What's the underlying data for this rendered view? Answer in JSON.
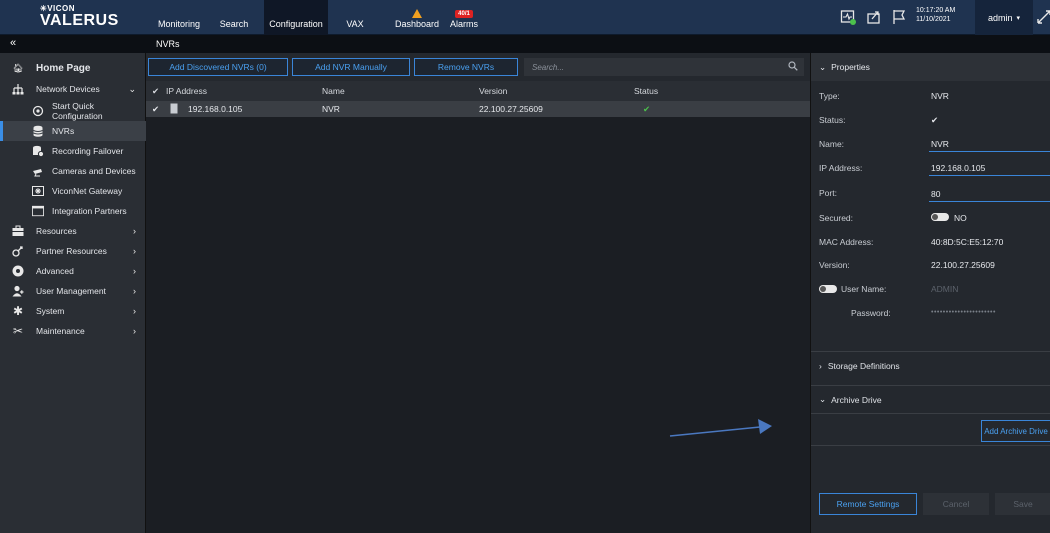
{
  "app": {
    "logo_top": "VICON",
    "logo_main": "VALERUS"
  },
  "nav": {
    "tabs": [
      {
        "label": "Monitoring"
      },
      {
        "label": "Search"
      },
      {
        "label": "Configuration"
      },
      {
        "label": "VAX"
      },
      {
        "label": "Dashboard"
      },
      {
        "label": "Alarms",
        "badge": "40/1"
      }
    ],
    "time": "10:17:20 AM",
    "date": "11/10/2021",
    "user": "admin"
  },
  "breadcrumb": "NVRs",
  "sidebar": {
    "items": [
      {
        "label": "Home Page",
        "icon": "home-icon"
      },
      {
        "label": "Network Devices",
        "icon": "network-icon"
      },
      {
        "label": "Start Quick Configuration",
        "icon": "quick-config-icon"
      },
      {
        "label": "NVRs",
        "icon": "database-icon"
      },
      {
        "label": "Recording Failover",
        "icon": "failover-icon"
      },
      {
        "label": "Cameras and Devices",
        "icon": "camera-icon"
      },
      {
        "label": "ViconNet Gateway",
        "icon": "gateway-icon"
      },
      {
        "label": "Integration Partners",
        "icon": "window-icon"
      },
      {
        "label": "Resources",
        "icon": "briefcase-icon"
      },
      {
        "label": "Partner Resources",
        "icon": "handshake-icon"
      },
      {
        "label": "Advanced",
        "icon": "advanced-icon"
      },
      {
        "label": "User Management",
        "icon": "users-icon"
      },
      {
        "label": "System",
        "icon": "gear-icon"
      },
      {
        "label": "Maintenance",
        "icon": "tools-icon"
      }
    ]
  },
  "toolbar": {
    "add_discovered": "Add Discovered NVRs (0)",
    "add_manual": "Add NVR Manually",
    "remove": "Remove NVRs",
    "search_placeholder": "Search..."
  },
  "table": {
    "columns": [
      "IP Address",
      "Name",
      "Version",
      "Status"
    ],
    "rows": [
      {
        "ip": "192.168.0.105",
        "name": "NVR",
        "version": "22.100.27.25609",
        "status": "ok"
      }
    ]
  },
  "properties": {
    "header": "Properties",
    "type_label": "Type:",
    "type_value": "NVR",
    "status_label": "Status:",
    "name_label": "Name:",
    "name_value": "NVR",
    "ip_label": "IP Address:",
    "ip_value": "192.168.0.105",
    "port_label": "Port:",
    "port_value": "80",
    "secured_label": "Secured:",
    "secured_value": "NO",
    "mac_label": "MAC Address:",
    "mac_value": "40:8D:5C:E5:12:70",
    "version_label": "Version:",
    "version_value": "22.100.27.25609",
    "username_label": "User Name:",
    "username_value": "ADMIN",
    "password_label": "Password:",
    "password_value": "••••••••••••••••••••••",
    "storage_section": "Storage Definitions",
    "archive_section": "Archive Drive",
    "add_archive": "Add Archive Drive",
    "remote_settings": "Remote Settings",
    "cancel": "Cancel",
    "save": "Save"
  },
  "colors": {
    "accent": "#3a85d8",
    "topbar": "#1f3350",
    "ok": "#4cc14c",
    "annotation_arrow": "#4a78c0"
  }
}
